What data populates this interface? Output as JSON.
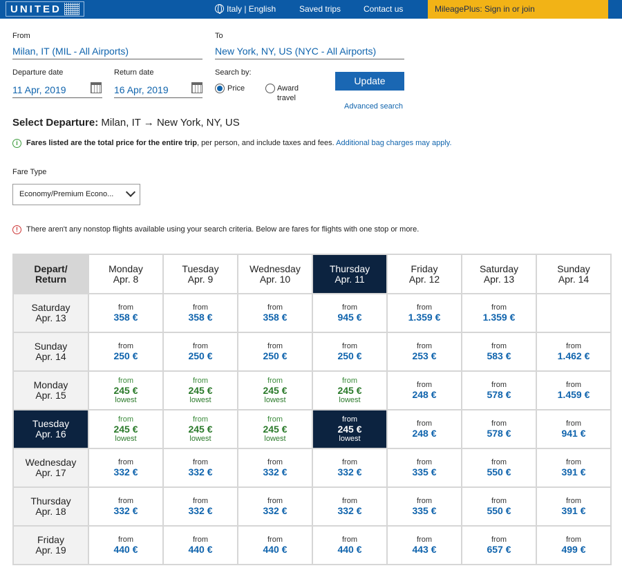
{
  "header": {
    "logo": "UNITED",
    "language": "Italy | English",
    "saved_trips": "Saved trips",
    "contact_us": "Contact us",
    "mileageplus": "MileagePlus: Sign in or join"
  },
  "search": {
    "from_label": "From",
    "from_value": "Milan, IT (MIL - All Airports)",
    "to_label": "To",
    "to_value": "New York, NY, US (NYC - All Airports)",
    "departure_label": "Departure date",
    "departure_value": "11 Apr, 2019",
    "return_label": "Return date",
    "return_value": "16 Apr, 2019",
    "search_by_label": "Search by:",
    "price_label": "Price",
    "award_label_1": "Award",
    "award_label_2": "travel",
    "update_button": "Update",
    "advanced_search": "Advanced search"
  },
  "select_departure": {
    "label": "Select Departure:",
    "route": "Milan, IT → New York, NY, US"
  },
  "fare_note": {
    "bold": "Fares listed are the total price for the entire trip",
    "rest": ", per person, and include taxes and fees.",
    "link": "Additional bag charges may apply."
  },
  "fare_type": {
    "label": "Fare Type",
    "value": "Economy/Premium Econo..."
  },
  "nonstop_warning": "There aren't any nonstop flights available using your search criteria. Below are fares for flights with one stop or more.",
  "grid": {
    "corner_1": "Depart/",
    "corner_2": "Return",
    "from_text": "from",
    "lowest_text": "lowest",
    "columns": [
      {
        "day": "Monday",
        "date": "Apr. 8"
      },
      {
        "day": "Tuesday",
        "date": "Apr. 9"
      },
      {
        "day": "Wednesday",
        "date": "Apr. 10"
      },
      {
        "day": "Thursday",
        "date": "Apr. 11"
      },
      {
        "day": "Friday",
        "date": "Apr. 12"
      },
      {
        "day": "Saturday",
        "date": "Apr. 13"
      },
      {
        "day": "Sunday",
        "date": "Apr. 14"
      }
    ],
    "selected_column": 3,
    "selected_row": 3,
    "rows": [
      {
        "day": "Saturday",
        "date": "Apr. 13",
        "prices": [
          "358 €",
          "358 €",
          "358 €",
          "945 €",
          "1.359 €",
          "1.359 €",
          ""
        ]
      },
      {
        "day": "Sunday",
        "date": "Apr. 14",
        "prices": [
          "250 €",
          "250 €",
          "250 €",
          "250 €",
          "253 €",
          "583 €",
          "1.462 €"
        ]
      },
      {
        "day": "Monday",
        "date": "Apr. 15",
        "prices": [
          "245 €",
          "245 €",
          "245 €",
          "245 €",
          "248 €",
          "578 €",
          "1.459 €"
        ],
        "lowest": [
          true,
          true,
          true,
          true,
          false,
          false,
          false
        ]
      },
      {
        "day": "Tuesday",
        "date": "Apr. 16",
        "prices": [
          "245 €",
          "245 €",
          "245 €",
          "245 €",
          "248 €",
          "578 €",
          "941 €"
        ],
        "lowest": [
          true,
          true,
          true,
          true,
          false,
          false,
          false
        ]
      },
      {
        "day": "Wednesday",
        "date": "Apr. 17",
        "prices": [
          "332 €",
          "332 €",
          "332 €",
          "332 €",
          "335 €",
          "550 €",
          "391 €"
        ]
      },
      {
        "day": "Thursday",
        "date": "Apr. 18",
        "prices": [
          "332 €",
          "332 €",
          "332 €",
          "332 €",
          "335 €",
          "550 €",
          "391 €"
        ]
      },
      {
        "day": "Friday",
        "date": "Apr. 19",
        "prices": [
          "440 €",
          "440 €",
          "440 €",
          "440 €",
          "443 €",
          "657 €",
          "499 €"
        ]
      }
    ]
  }
}
